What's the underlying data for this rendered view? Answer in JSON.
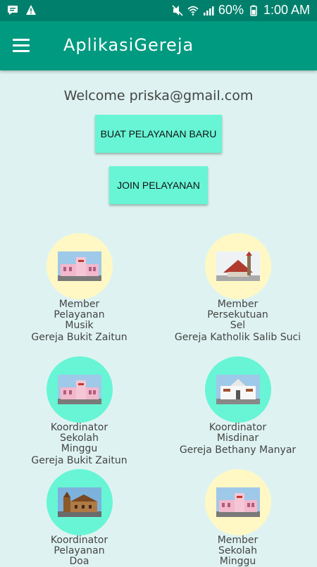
{
  "status_bar": {
    "battery": "60%",
    "time": "1:00 AM"
  },
  "appbar": {
    "title": "AplikasiGereja"
  },
  "welcome_text": "Welcome priska@gmail.com",
  "buttons": {
    "create": "BUAT PELAYANAN BARU",
    "join": "JOIN PELAYANAN"
  },
  "cards": [
    {
      "role": "Member",
      "service": [
        "Pelayanan",
        "Musik"
      ],
      "church": "Gereja Bukit Zaitun",
      "circle": "yellow",
      "photo": "pink-church"
    },
    {
      "role": "Member",
      "service": [
        "Persekutuan",
        "Sel"
      ],
      "church": "Gereja Katholik Salib Suci",
      "circle": "yellow",
      "photo": "red-roof-church"
    },
    {
      "role": "Koordinator",
      "service": [
        "Sekolah",
        "Minggu"
      ],
      "church": "Gereja Bukit Zaitun",
      "circle": "mint",
      "photo": "pink-church"
    },
    {
      "role": "Koordinator",
      "service": [
        "Misdinar"
      ],
      "church": "Gereja Bethany Manyar",
      "circle": "mint",
      "photo": "white-church"
    },
    {
      "role": "Koordinator",
      "service": [
        "Pelayanan",
        "Doa"
      ],
      "church": "",
      "circle": "mint",
      "photo": "brown-church"
    },
    {
      "role": "Member",
      "service": [
        "Sekolah",
        "Minggu"
      ],
      "church": "",
      "circle": "yellow",
      "photo": "pink-church"
    }
  ],
  "colors": {
    "status_bar": "#00806c",
    "appbar": "#009a80",
    "background": "#def3f1",
    "button": "#67f5d5",
    "circle_yellow": "#fff8c4",
    "circle_mint": "#67f5d5"
  }
}
